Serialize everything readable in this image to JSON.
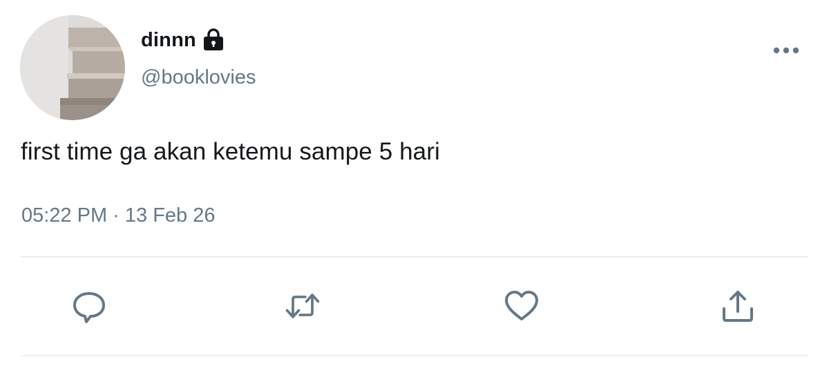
{
  "user": {
    "display_name": "dinnn",
    "handle": "@booklovies",
    "protected_icon": "lock-icon",
    "avatar": "stacked-books-photo"
  },
  "tweet": {
    "text": "first time ga akan ketemu sampe 5 hari",
    "timestamp": "05:22 PM · 13 Feb 26"
  },
  "menu": {
    "icon": "more-horizontal-icon"
  },
  "actions": [
    {
      "name": "reply",
      "icon": "speech-bubble-icon"
    },
    {
      "name": "retweet",
      "icon": "retweet-arrows-icon"
    },
    {
      "name": "like",
      "icon": "heart-icon"
    },
    {
      "name": "share",
      "icon": "share-upload-icon"
    }
  ],
  "colors": {
    "primary_text": "#14171a",
    "secondary_text": "#657786",
    "icon": "#657786",
    "divider": "#e6ecf0",
    "background": "#ffffff"
  }
}
